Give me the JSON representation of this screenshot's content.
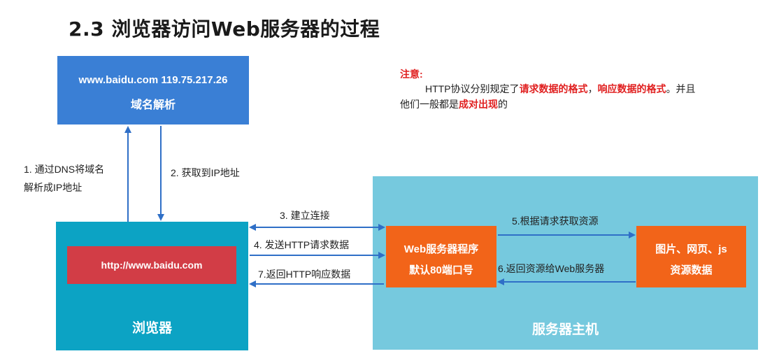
{
  "title": "2.3 浏览器访问Web服务器的过程",
  "dns": {
    "line1": "www.baidu.com 119.75.217.26",
    "line2": "域名解析"
  },
  "browser": {
    "url": "http://www.baidu.com",
    "label": "浏览器"
  },
  "server": {
    "label": "服务器主机",
    "program": {
      "line1": "Web服务器程序",
      "line2": "默认80端口号"
    },
    "resources": {
      "line1": "图片、网页、js",
      "line2": "资源数据"
    }
  },
  "steps": {
    "s1_line1": "1. 通过DNS将域名",
    "s1_line2": "解析成IP地址",
    "s2": "2. 获取到IP地址",
    "s3": "3. 建立连接",
    "s4": "4. 发送HTTP请求数据",
    "s5": "5.根据请求获取资源",
    "s6": "6.返回资源给Web服务器",
    "s7": "7.返回HTTP响应数据"
  },
  "note": {
    "heading": "注意:",
    "p1": "HTTP协议分别规定了",
    "p2": "请求数据的格式",
    "p3": "，",
    "p4": "响应数据的格式",
    "p5": "。并且",
    "p6": "他们一般都是",
    "p7": "成对出现",
    "p8": "的"
  },
  "colors": {
    "dns_box": "#3a7fd5",
    "browser_box": "#0ca3c4",
    "url_box": "#d23d46",
    "server_host": "#76c9de",
    "orange_box": "#f26419",
    "arrow": "#2f6fc7",
    "highlight": "#e02020"
  }
}
